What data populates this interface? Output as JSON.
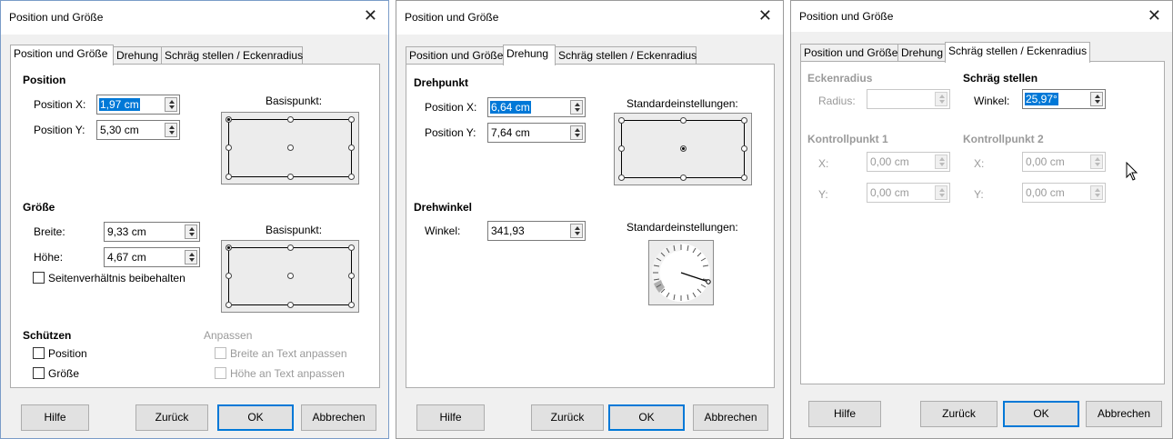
{
  "colors": {
    "accent": "#0078d7",
    "panel": "#ffffff",
    "dialog_bg": "#f0f0f0",
    "disabled_text": "#9a9a9a"
  },
  "icons": {
    "close": "close-icon",
    "cursor": "mouse-pointer-icon"
  },
  "tabs": {
    "position": "Position und Größe",
    "rotation": "Drehung",
    "slant": "Schräg stellen / Eckenradius"
  },
  "buttons": {
    "help": "Hilfe",
    "reset": "Zurück",
    "ok": "OK",
    "cancel": "Abbrechen"
  },
  "dialog1": {
    "title": "Position und Größe",
    "position_header": "Position",
    "position_x_label": "Position X:",
    "position_x_value": "1,97 cm",
    "position_y_label": "Position Y:",
    "position_y_value": "5,30 cm",
    "base_point_label": "Basispunkt:",
    "size_header": "Größe",
    "width_label": "Breite:",
    "width_value": "9,33 cm",
    "height_label": "Höhe:",
    "height_value": "4,67 cm",
    "keep_ratio_label": "Seitenverhältnis beibehalten",
    "base_point_label_2": "Basispunkt:",
    "protect_header": "Schützen",
    "protect_position": "Position",
    "protect_size": "Größe",
    "adapt_header": "Anpassen",
    "fit_width": "Breite an Text anpassen",
    "fit_height": "Höhe an Text anpassen"
  },
  "dialog2": {
    "title": "Position und Größe",
    "pivot_header": "Drehpunkt",
    "position_x_label": "Position X:",
    "position_x_value": "6,64 cm",
    "position_y_label": "Position Y:",
    "position_y_value": "7,64 cm",
    "defaults_label": "Standardeinstellungen:",
    "angle_header": "Drehwinkel",
    "angle_label": "Winkel:",
    "angle_value": "341,93",
    "defaults_label_2": "Standardeinstellungen:"
  },
  "dialog3": {
    "title": "Position und Größe",
    "corner_header": "Eckenradius",
    "radius_label": "Radius:",
    "radius_value": "",
    "slant_header": "Schräg stellen",
    "slant_angle_label": "Winkel:",
    "slant_angle_value": "25,97°",
    "control1_header": "Kontrollpunkt 1",
    "control2_header": "Kontrollpunkt 2",
    "cp1_x_label": "X:",
    "cp1_x_value": "0,00 cm",
    "cp1_y_label": "Y:",
    "cp1_y_value": "0,00 cm",
    "cp2_x_label": "X:",
    "cp2_x_value": "0,00 cm",
    "cp2_y_label": "Y:",
    "cp2_y_value": "0,00 cm"
  }
}
